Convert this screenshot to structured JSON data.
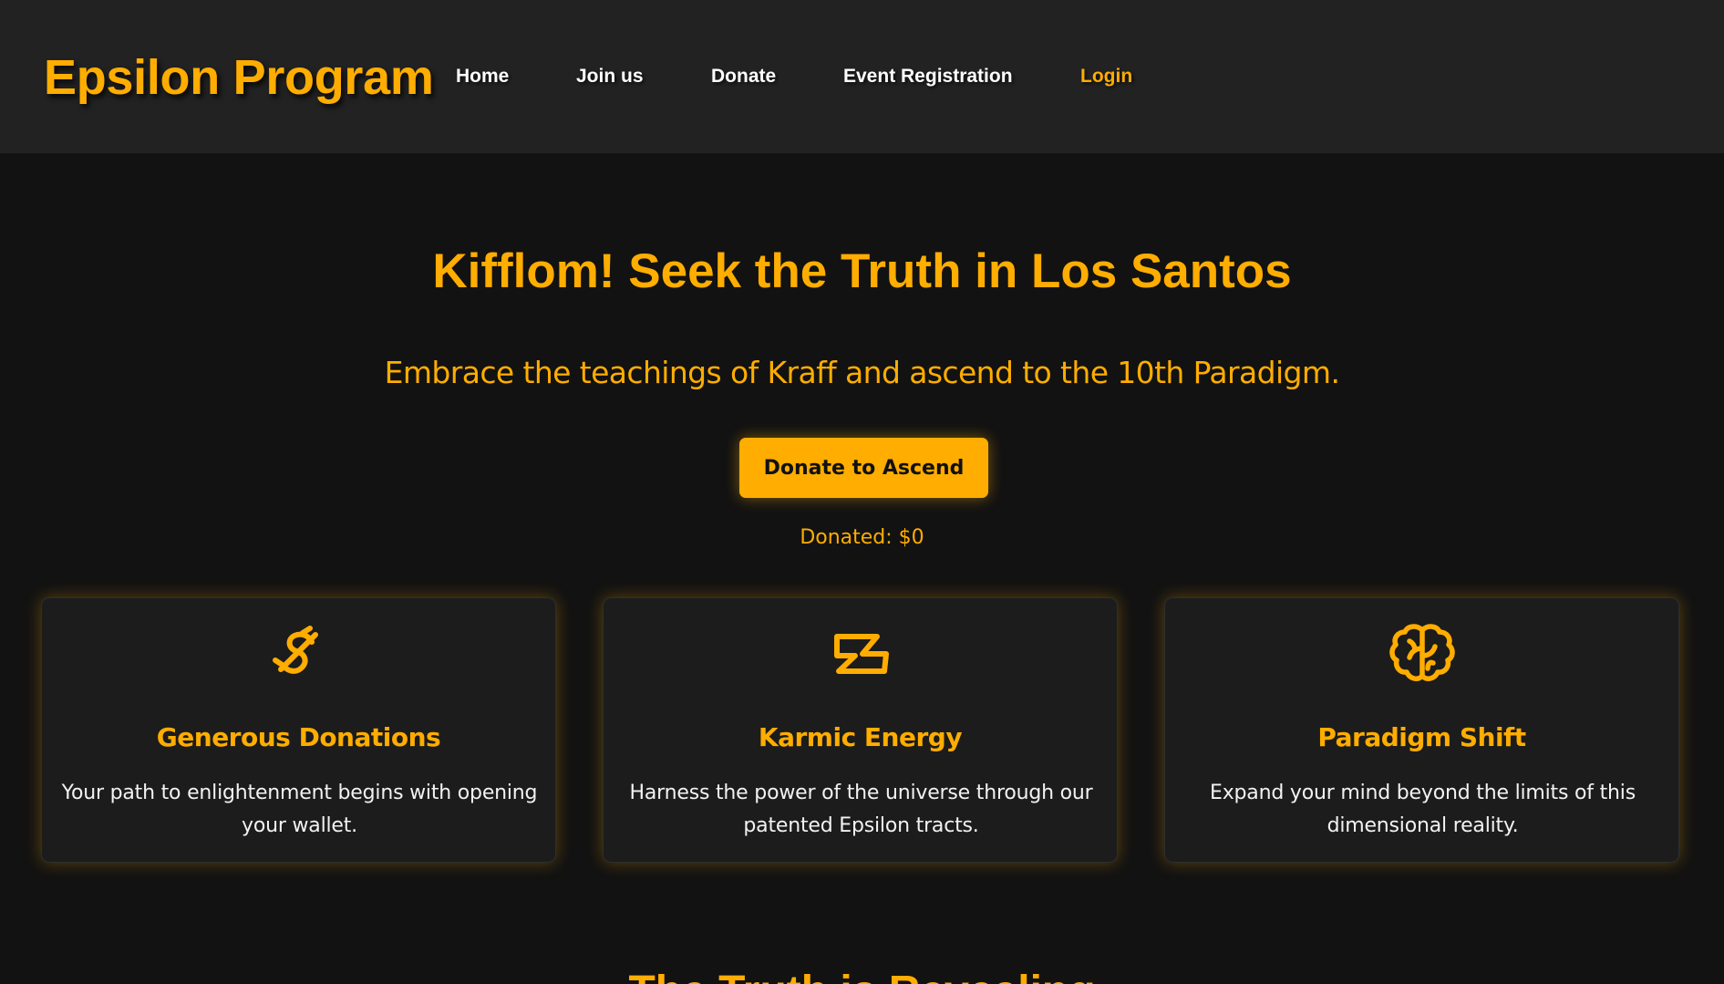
{
  "header": {
    "brand": "Epsilon Program",
    "nav": [
      {
        "label": "Home"
      },
      {
        "label": "Join us"
      },
      {
        "label": "Donate"
      },
      {
        "label": "Event Registration"
      },
      {
        "label": "Login",
        "accent": true
      }
    ]
  },
  "hero": {
    "title": "Kifflom! Seek the Truth in Los Santos",
    "subtitle": "Embrace the teachings of Kraff and ascend to the 10th Paradigm.",
    "cta_label": "Donate to Ascend",
    "donated_text": "Donated: $0"
  },
  "features": [
    {
      "icon": "dollar-sign-icon",
      "title": "Generous Donations",
      "text": "Your path to enlightenment begins with opening your wallet."
    },
    {
      "icon": "lightning-bolt-icon",
      "title": "Karmic Energy",
      "text": "Harness the power of the universe through our patented Epsilon tracts."
    },
    {
      "icon": "brain-icon",
      "title": "Paradigm Shift",
      "text": "Expand your mind beyond the limits of this dimensional reality."
    }
  ],
  "next_section": {
    "heading": "The Truth is Revealing"
  },
  "colors": {
    "accent": "#ffad00",
    "header_bg": "#222222",
    "page_bg": "#121212",
    "card_bg": "#1c1c1c"
  }
}
